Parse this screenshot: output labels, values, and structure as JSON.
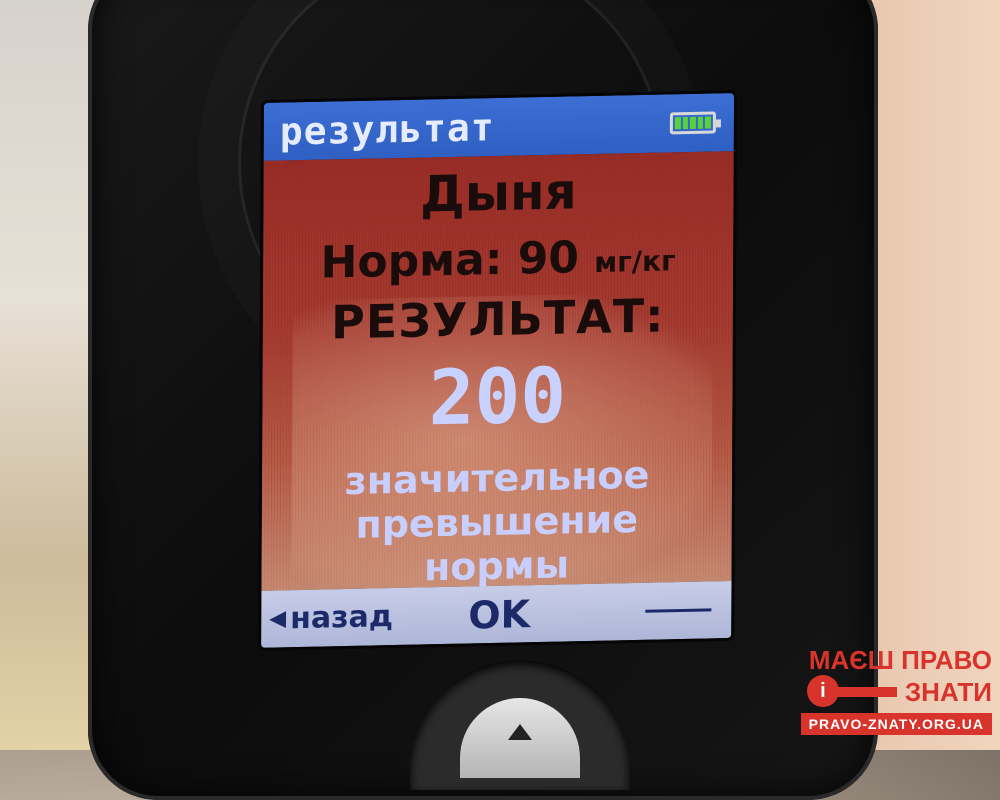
{
  "screen": {
    "title": "результат",
    "battery_icon": "battery-full-icon",
    "product": "Дыня",
    "norm_label": "Норма: 90",
    "norm_unit": "мг/кг",
    "result_label": "РЕЗУЛЬТАТ:",
    "result_value": "200",
    "message_line1": "значительное",
    "message_line2": "превышение",
    "message_line3": "нормы",
    "back_label": "назад",
    "ok_label": "OK",
    "colors": {
      "titlebar": "#2f5fc2",
      "content": "#a63a30",
      "result_value": "#c9d2ff",
      "battery": "#58d23a"
    }
  },
  "watermark": {
    "line1": "МАЄШ ПРАВО",
    "line2": "ЗНАТИ",
    "key_glyph": "i",
    "url": "PRAVO-ZNATY.ORG.UA",
    "color": "#d9342c"
  }
}
